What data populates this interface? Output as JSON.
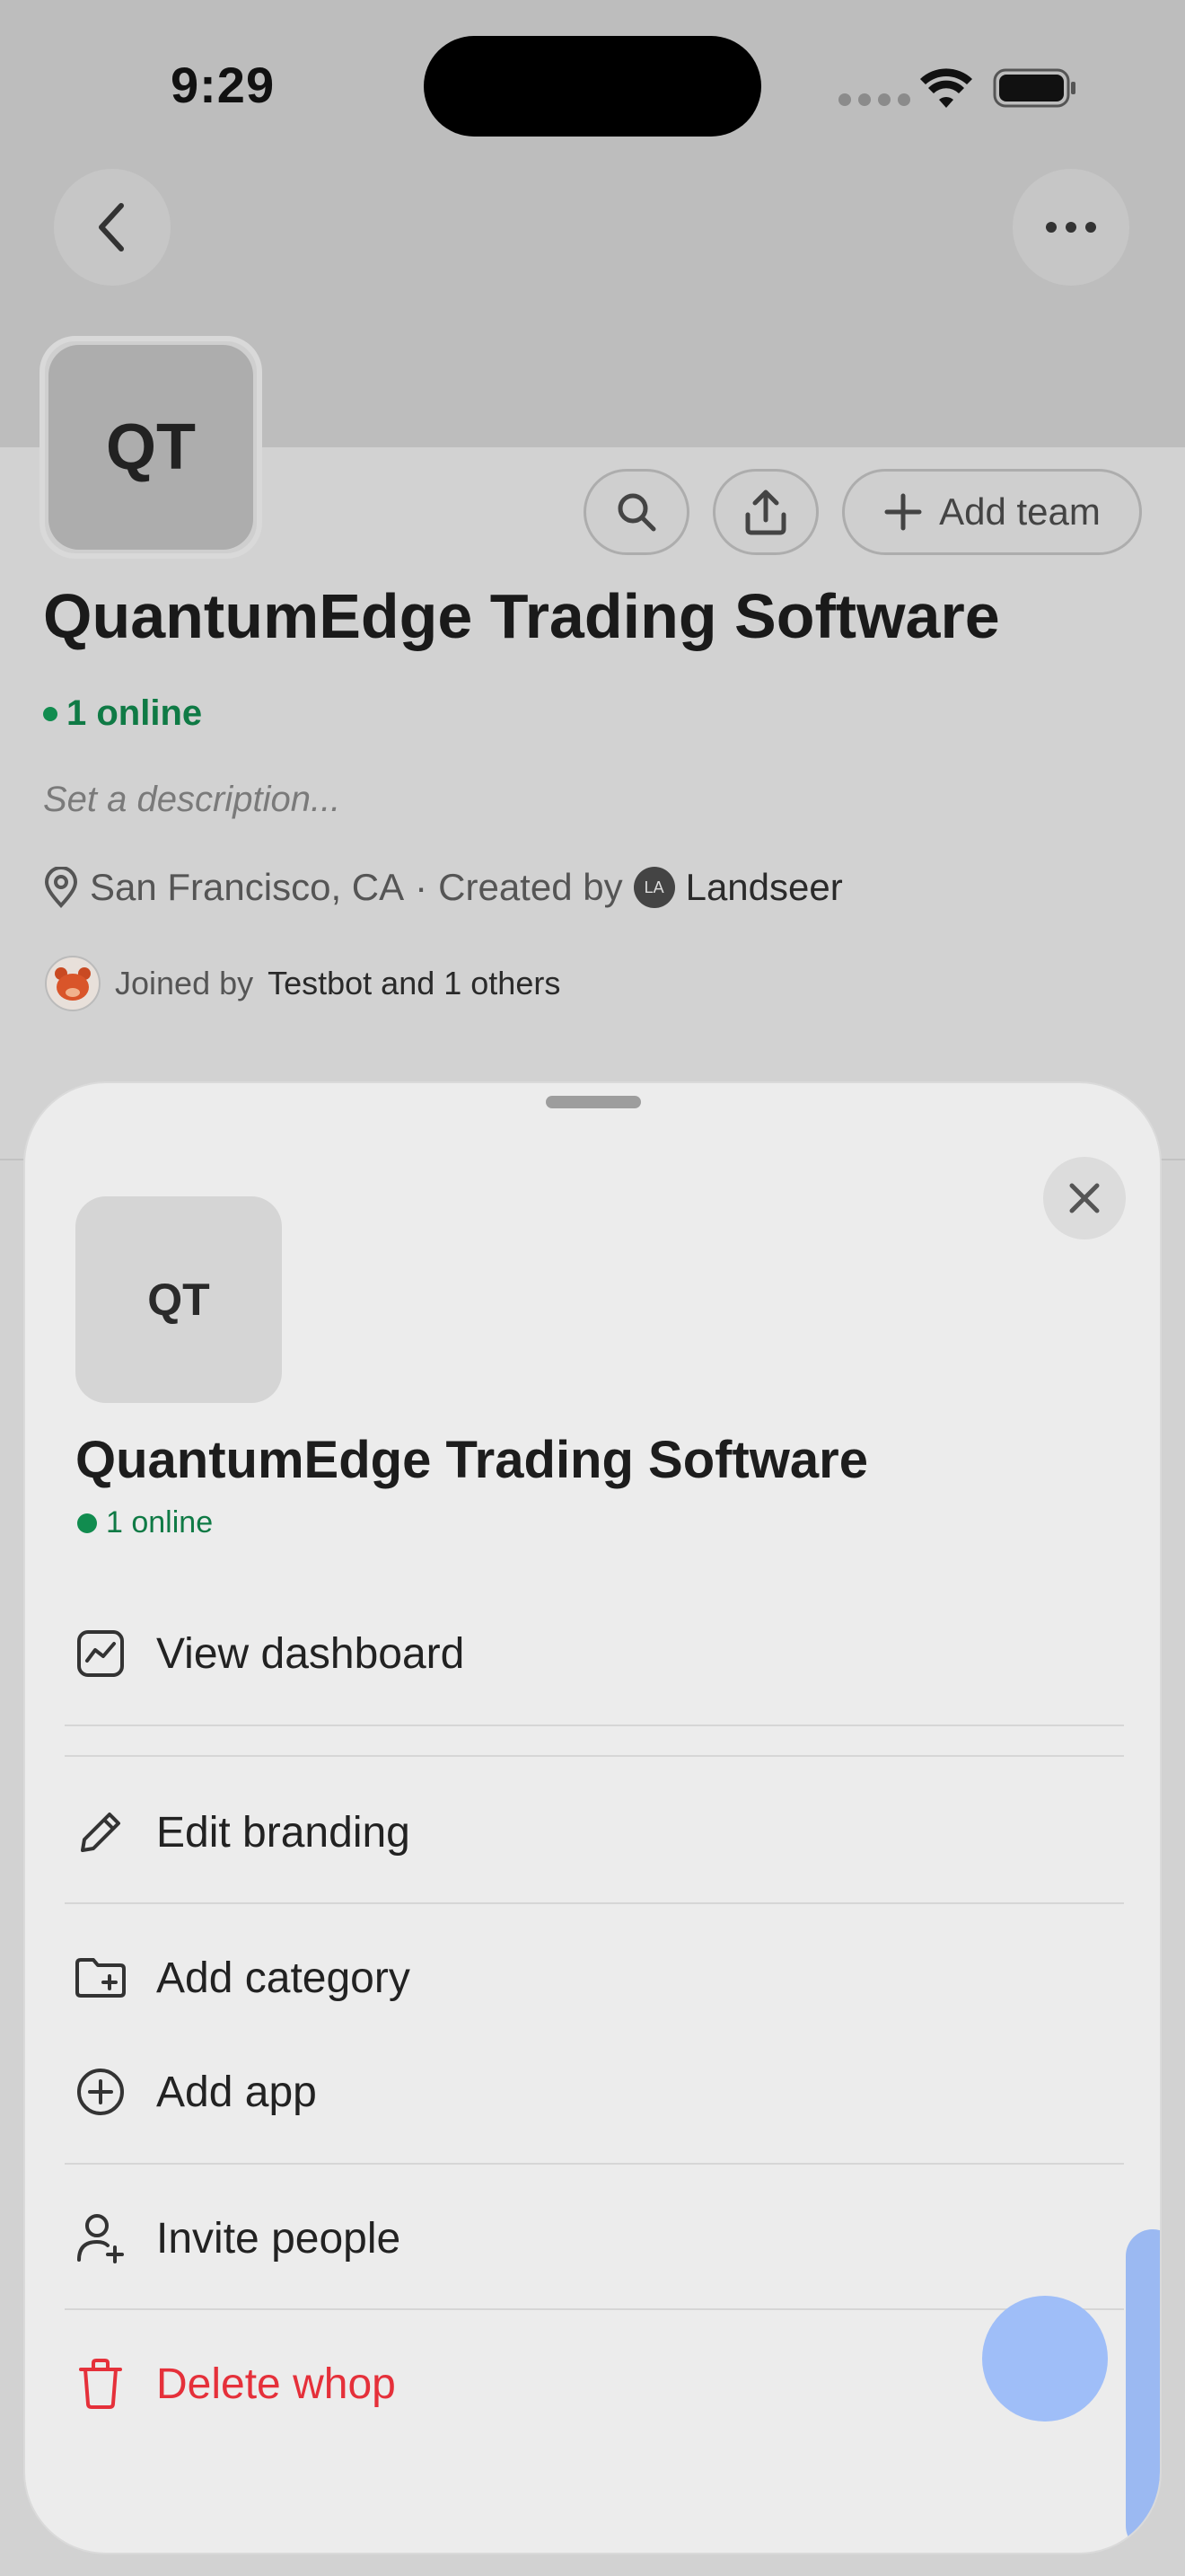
{
  "status_bar": {
    "time": "9:29"
  },
  "org": {
    "initials": "QT",
    "name": "QuantumEdge Trading Software",
    "online": "1 online",
    "description_placeholder": "Set a description...",
    "location": "San Francisco, CA",
    "separator": "·",
    "created_by_label": "Created by",
    "creator_initials": "LA",
    "creator_name": "Landseer",
    "joined_by_label": "Joined by",
    "joined_by_names": "Testbot and 1 others"
  },
  "header_actions": {
    "add_team_label": "Add team"
  },
  "sheet": {
    "initials": "QT",
    "title": "QuantumEdge Trading Software",
    "online": "1 online",
    "menu": [
      {
        "label": "View dashboard",
        "icon": "chart-icon"
      },
      {
        "label": "Edit branding",
        "icon": "pencil-icon"
      },
      {
        "label": "Add category",
        "icon": "folder-plus-icon"
      },
      {
        "label": "Add app",
        "icon": "plus-circle-icon"
      },
      {
        "label": "Invite people",
        "icon": "user-plus-icon"
      },
      {
        "label": "Delete whop",
        "icon": "trash-icon"
      }
    ]
  },
  "colors": {
    "online_green": "#118c4f",
    "danger_red": "#e5303a",
    "fab_blue": "#9fbef8"
  }
}
